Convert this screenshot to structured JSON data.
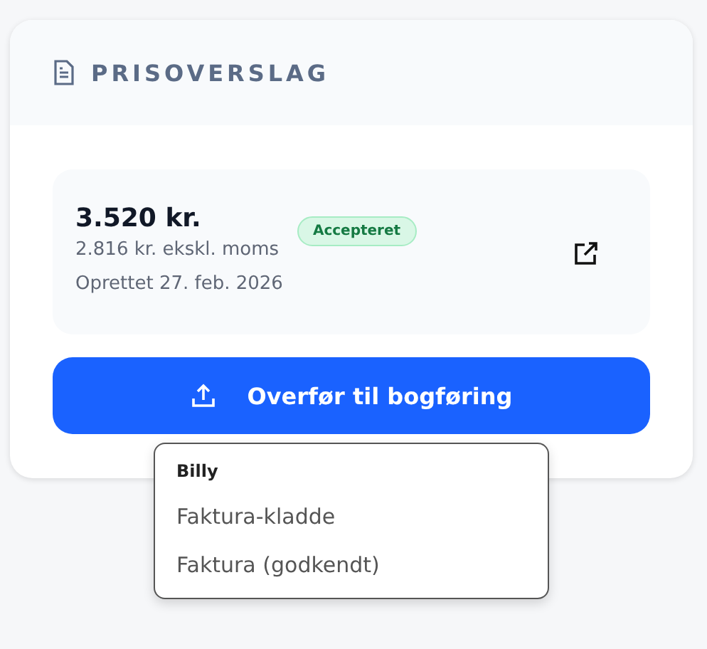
{
  "card": {
    "title": "PRISOVERSLAG"
  },
  "quote": {
    "amount": "3.520 kr.",
    "net": "2.816 kr. ekskl. moms",
    "created": "Oprettet 27. feb. 2026",
    "status": "Accepteret"
  },
  "button": {
    "label": "Overfør til bogføring"
  },
  "menu": {
    "heading": "Billy",
    "items": [
      {
        "label": "Faktura-kladde"
      },
      {
        "label": "Faktura (godkendt)"
      }
    ]
  }
}
